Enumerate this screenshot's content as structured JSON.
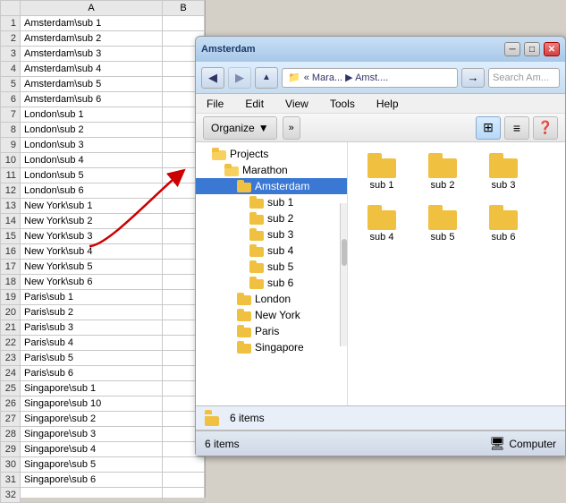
{
  "spreadsheet": {
    "col_headers": [
      "A",
      "B"
    ],
    "rows": [
      {
        "num": 1,
        "a": "Amsterdam\\sub 1",
        "selected": false
      },
      {
        "num": 2,
        "a": "Amsterdam\\sub 2",
        "selected": false
      },
      {
        "num": 3,
        "a": "Amsterdam\\sub 3",
        "selected": false
      },
      {
        "num": 4,
        "a": "Amsterdam\\sub 4",
        "selected": false
      },
      {
        "num": 5,
        "a": "Amsterdam\\sub 5",
        "selected": false
      },
      {
        "num": 6,
        "a": "Amsterdam\\sub 6",
        "selected": false
      },
      {
        "num": 7,
        "a": "London\\sub 1",
        "selected": false
      },
      {
        "num": 8,
        "a": "London\\sub 2",
        "selected": false
      },
      {
        "num": 9,
        "a": "London\\sub 3",
        "selected": false
      },
      {
        "num": 10,
        "a": "London\\sub 4",
        "selected": false
      },
      {
        "num": 11,
        "a": "London\\sub 5",
        "selected": false
      },
      {
        "num": 12,
        "a": "London\\sub 6",
        "selected": false
      },
      {
        "num": 13,
        "a": "New York\\sub 1",
        "selected": false
      },
      {
        "num": 14,
        "a": "New York\\sub 2",
        "selected": false
      },
      {
        "num": 15,
        "a": "New York\\sub 3",
        "selected": false
      },
      {
        "num": 16,
        "a": "New York\\sub 4",
        "selected": false
      },
      {
        "num": 17,
        "a": "New York\\sub 5",
        "selected": false
      },
      {
        "num": 18,
        "a": "New York\\sub 6",
        "selected": false
      },
      {
        "num": 19,
        "a": "Paris\\sub 1",
        "selected": false
      },
      {
        "num": 20,
        "a": "Paris\\sub 2",
        "selected": false
      },
      {
        "num": 21,
        "a": "Paris\\sub 3",
        "selected": false
      },
      {
        "num": 22,
        "a": "Paris\\sub 4",
        "selected": false
      },
      {
        "num": 23,
        "a": "Paris\\sub 5",
        "selected": false
      },
      {
        "num": 24,
        "a": "Paris\\sub 6",
        "selected": false
      },
      {
        "num": 25,
        "a": "Singapore\\sub 1",
        "selected": false
      },
      {
        "num": 26,
        "a": "Singapore\\sub 10",
        "selected": false
      },
      {
        "num": 27,
        "a": "Singapore\\sub 2",
        "selected": false
      },
      {
        "num": 28,
        "a": "Singapore\\sub 3",
        "selected": false
      },
      {
        "num": 29,
        "a": "Singapore\\sub 4",
        "selected": false
      },
      {
        "num": 30,
        "a": "Singapore\\sub 5",
        "selected": false
      },
      {
        "num": 31,
        "a": "Singapore\\sub 6",
        "selected": false
      },
      {
        "num": 32,
        "a": "",
        "selected": false
      }
    ]
  },
  "explorer": {
    "title": "Amsterdam",
    "title_bar_text": "Amsterdam",
    "address": {
      "back_label": "◀",
      "forward_label": "▶",
      "parts": [
        "« Mara...",
        "▶",
        "Amst...."
      ],
      "go_label": "→",
      "search_placeholder": "Search Am..."
    },
    "menu": {
      "items": [
        "File",
        "Edit",
        "View",
        "Tools",
        "Help"
      ]
    },
    "toolbar": {
      "organize_label": "Organize",
      "organize_arrow": "▼",
      "more_label": "»",
      "view_options": [
        "⊞",
        "≡",
        "❓"
      ]
    },
    "nav_tree": {
      "items": [
        {
          "label": "Projects",
          "indent": 1,
          "expanded": true
        },
        {
          "label": "Marathon",
          "indent": 2,
          "expanded": true
        },
        {
          "label": "Amsterdam",
          "indent": 3,
          "expanded": true,
          "selected": true
        },
        {
          "label": "sub 1",
          "indent": 4
        },
        {
          "label": "sub 2",
          "indent": 4
        },
        {
          "label": "sub 3",
          "indent": 4
        },
        {
          "label": "sub 4",
          "indent": 4
        },
        {
          "label": "sub 5",
          "indent": 4
        },
        {
          "label": "sub 6",
          "indent": 4
        },
        {
          "label": "London",
          "indent": 3
        },
        {
          "label": "New York",
          "indent": 3
        },
        {
          "label": "Paris",
          "indent": 3
        },
        {
          "label": "Singapore",
          "indent": 3
        }
      ]
    },
    "file_panel": {
      "items": [
        {
          "label": "sub 1"
        },
        {
          "label": "sub 2"
        },
        {
          "label": "sub 3"
        },
        {
          "label": "sub 4"
        },
        {
          "label": "sub 5"
        },
        {
          "label": "sub 6"
        }
      ]
    },
    "preview_bar": {
      "count_label": "6 items",
      "folder_visible": true
    },
    "status_bar": {
      "left_label": "6 items",
      "right_label": "Computer"
    }
  }
}
